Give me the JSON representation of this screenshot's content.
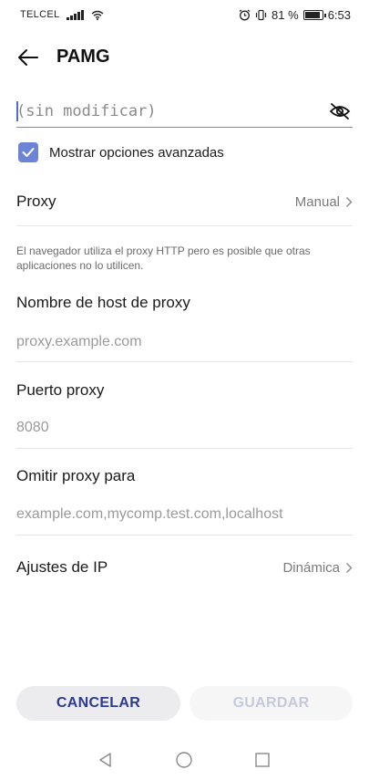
{
  "status_bar": {
    "carrier": "TELCEL",
    "battery_text": "81 %",
    "battery_level": 0.81,
    "time": "6:53",
    "icons": [
      "signal-icon",
      "wifi-icon",
      "alarm-icon",
      "vibrate-icon",
      "battery-icon"
    ]
  },
  "header": {
    "title": "PAMG",
    "back_icon": "arrow-left-icon"
  },
  "password": {
    "placeholder": "(sin modificar)",
    "visibility_icon": "eye-off-icon"
  },
  "advanced": {
    "label": "Mostrar opciones avanzadas",
    "checked": true
  },
  "proxy": {
    "label": "Proxy",
    "value": "Manual"
  },
  "proxy_note": "El navegador utiliza el proxy HTTP pero es posible que otras aplicaciones no lo utilicen.",
  "hostname": {
    "label": "Nombre de host de proxy",
    "placeholder": "proxy.example.com"
  },
  "port": {
    "label": "Puerto proxy",
    "placeholder": "8080"
  },
  "bypass": {
    "label": "Omitir proxy para",
    "placeholder": "example.com,mycomp.test.com,localhost"
  },
  "ip_settings": {
    "label": "Ajustes de IP",
    "value": "Dinámica"
  },
  "buttons": {
    "cancel": "CANCELAR",
    "save": "GUARDAR"
  },
  "navbar": {
    "icons": [
      "back-triangle-icon",
      "home-circle-icon",
      "recents-square-icon"
    ]
  },
  "colors": {
    "accent": "#6d84d6",
    "cancel_text": "#2c3a8f",
    "save_text_disabled": "#c4c9dc"
  }
}
